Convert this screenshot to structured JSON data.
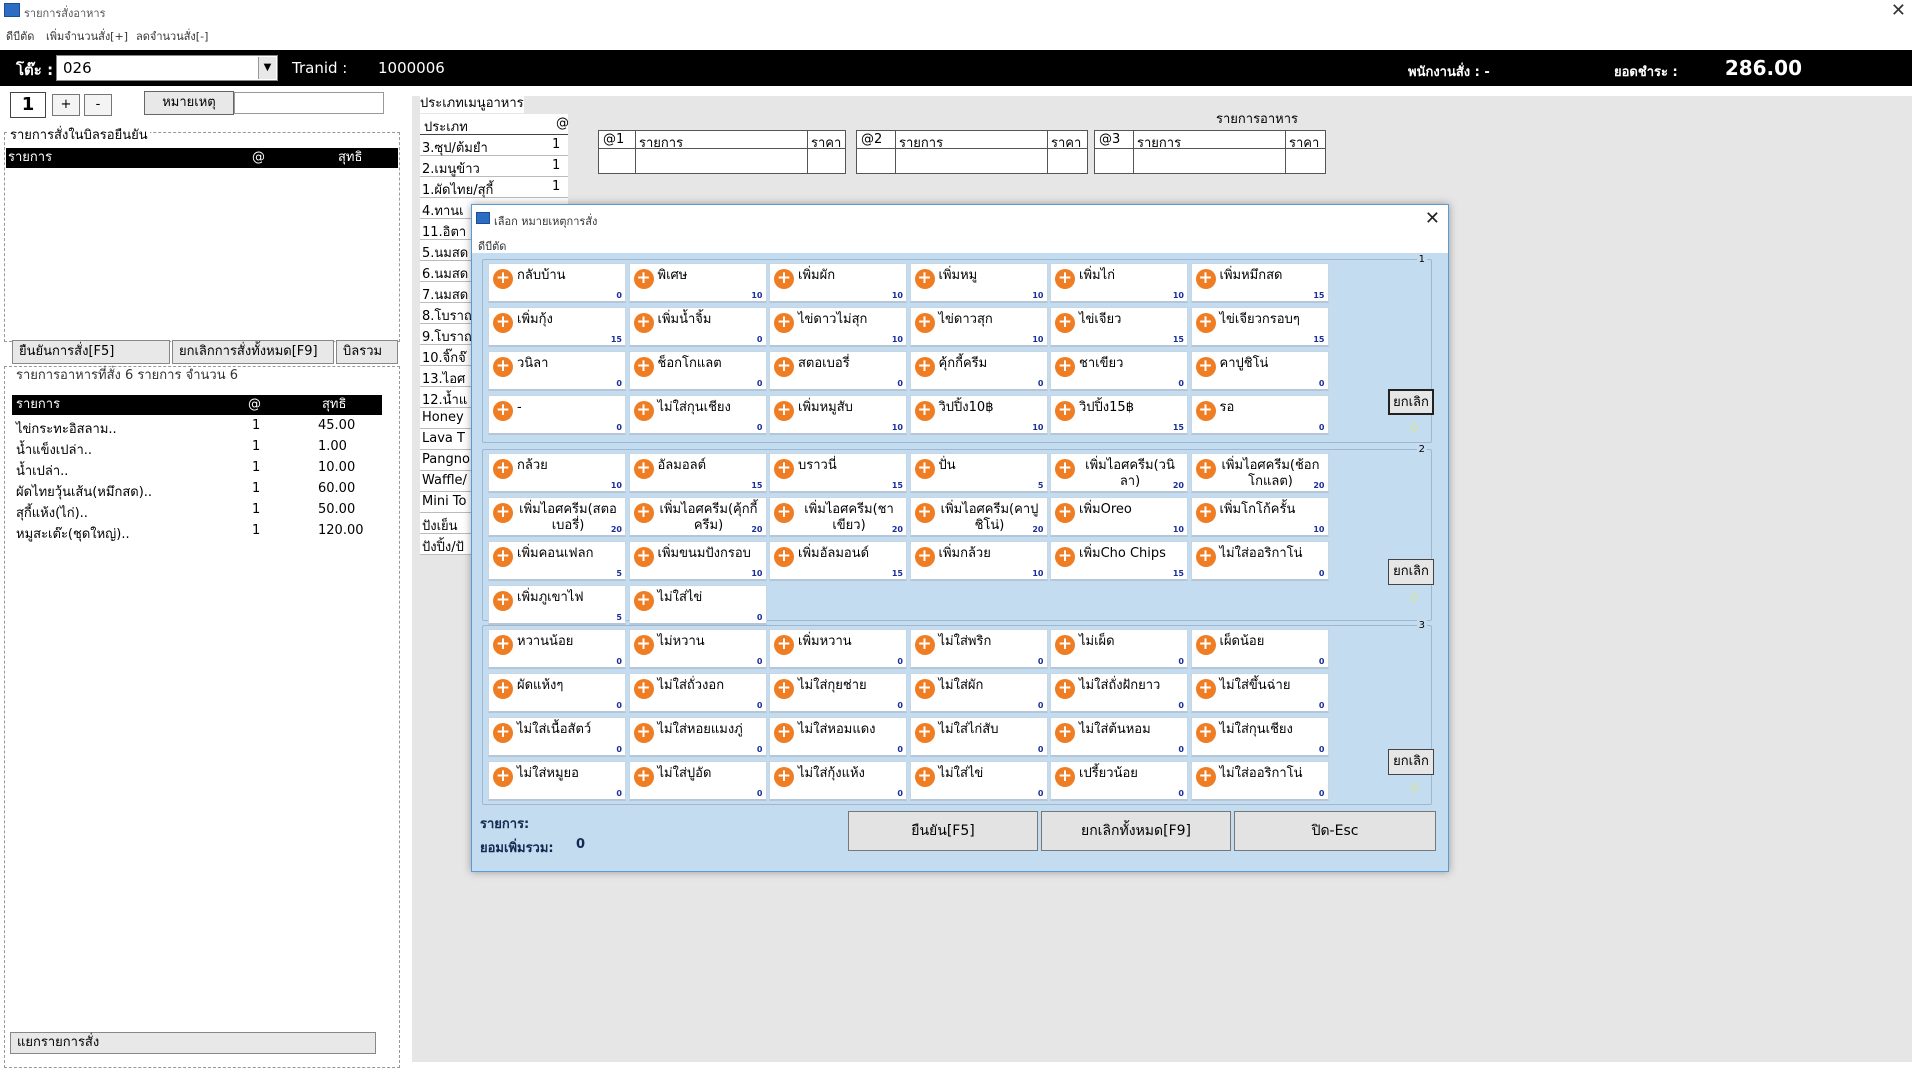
{
  "window": {
    "title": "รายการสั่งอาหาร"
  },
  "menu": [
    "ดีบีตัด",
    "เพิ่มจำนวนสั่ง[+]",
    "ลดจำนวนสั่ง[-]"
  ],
  "header": {
    "table_label": "โต๊ะ :",
    "table_value": "026",
    "tranid_label": "Tranid :",
    "tranid_value": "1000006",
    "staff_label": "พนักงานสั่ง : -",
    "amount_label": "ยอดชำระ :",
    "amount_value": "286.00"
  },
  "left": {
    "qty": "1",
    "plus": "+",
    "minus": "-",
    "note_button": "หมายเหตุ",
    "pending_title": "รายการสั่งในบิลรอยืนยัน",
    "pending_cols": [
      "รายการ",
      "@",
      "สุทธิ"
    ],
    "confirm_btn": "ยืนยันการสั่ง[F5]",
    "cancel_all_btn": "ยกเลิกการสั่งทั้งหมด[F9]",
    "bill_btn": "บิลรวม",
    "summary_text": "รายการอาหารที่สั่ง  6 รายการ    จำนวน  6",
    "ordered_cols": [
      "รายการ",
      "@",
      "สุทธิ"
    ],
    "ordered_rows": [
      [
        "ไข่กระทะอิสลาม..",
        "1",
        "45.00"
      ],
      [
        "น้ำแข็งเปล่า..",
        "1",
        "1.00"
      ],
      [
        "น้ำเปล่า..",
        "1",
        "10.00"
      ],
      [
        "ผัดไทยวุ้นเส้น(หมึกสด)..",
        "1",
        "60.00"
      ],
      [
        "สุกี้แห้ง(ไก่)..",
        "1",
        "50.00"
      ],
      [
        "หมูสะเต๊ะ(ชุดใหญ่)..",
        "1",
        "120.00"
      ]
    ],
    "split_btn": "แยกรายการสั่ง"
  },
  "center": {
    "category_title": "ประเภทเมนูอาหาร",
    "food_title": "รายการอาหาร",
    "cat_cols": [
      "ประเภท",
      "@"
    ],
    "categories": [
      [
        "3.ซุป/ต้มยำ",
        "1"
      ],
      [
        "2.เมนูข้าว",
        "1"
      ],
      [
        "1.ผัดไทย/สุกี้",
        "1"
      ],
      [
        "4.ทานเ",
        ""
      ],
      [
        "11.อิตา",
        ""
      ],
      [
        "5.นมสด",
        ""
      ],
      [
        "6.นมสด",
        ""
      ],
      [
        "7.นมสด",
        ""
      ],
      [
        "8.โบราณ",
        ""
      ],
      [
        "9.โบราณ",
        ""
      ],
      [
        "10.จิ๊กจ๊",
        ""
      ],
      [
        "13.ไอศ",
        ""
      ],
      [
        "12.น้ำแ",
        ""
      ],
      [
        "Honey",
        ""
      ],
      [
        "Lava T",
        ""
      ],
      [
        "Pangno",
        ""
      ],
      [
        "Waffle/",
        ""
      ],
      [
        "Mini To",
        ""
      ],
      [
        "ปังเย็น",
        ""
      ],
      [
        "ปังปิ้ง/ปั",
        ""
      ]
    ],
    "grid1": [
      "@1",
      "รายการ",
      "ราคา"
    ],
    "grid2": [
      "@2",
      "รายการ",
      "ราคา"
    ],
    "grid3": [
      "@3",
      "รายการ",
      "ราคา"
    ]
  },
  "dialog": {
    "title": "เลือก หมายเหตุการสั่ง",
    "menu": "ดีบีตัด",
    "groups": [
      {
        "num": "1",
        "cancel": "ยกเลิก",
        "zero": "0",
        "items": [
          [
            "กลับบ้าน",
            "0"
          ],
          [
            "พิเศษ",
            "10"
          ],
          [
            "เพิ่มผัก",
            "10"
          ],
          [
            "เพิ่มหมู",
            "10"
          ],
          [
            "เพิ่มไก่",
            "10"
          ],
          [
            "เพิ่มหมึกสด",
            "15"
          ],
          [
            "เพิ่มกุ้ง",
            "15"
          ],
          [
            "เพิ่มน้ำจิ้ม",
            "0"
          ],
          [
            "ไข่ดาวไม่สุก",
            "10"
          ],
          [
            "ไข่ดาวสุก",
            "10"
          ],
          [
            "ไข่เจียว",
            "15"
          ],
          [
            "ไข่เจียวกรอบๆ",
            "15"
          ],
          [
            "วนิลา",
            "0"
          ],
          [
            "ช็อกโกแลต",
            "0"
          ],
          [
            "สตอเบอรี่",
            "0"
          ],
          [
            "คุ้กกี้ครีม",
            "0"
          ],
          [
            "ชาเขียว",
            "0"
          ],
          [
            "คาปูชิโน่",
            "0"
          ],
          [
            "-",
            "0"
          ],
          [
            "ไม่ใส่กุนเชียง",
            "0"
          ],
          [
            "เพิ่มหมูสับ",
            "10"
          ],
          [
            "วิปปิ้ง10฿",
            "10"
          ],
          [
            "วิปปิ้ง15฿",
            "15"
          ],
          [
            "รอ",
            "0"
          ]
        ]
      },
      {
        "num": "2",
        "cancel": "ยกเลิก",
        "zero": "0",
        "items": [
          [
            "กล้วย",
            "10"
          ],
          [
            "อัลมอลต์",
            "15"
          ],
          [
            "บราวนี่",
            "15"
          ],
          [
            "ปั่น",
            "5"
          ],
          [
            "เพิ่มไอศครีม(วนิลา)",
            "20"
          ],
          [
            "เพิ่มไอศครีม(ช้อกโกแลต)",
            "20"
          ],
          [
            "เพิ่มไอศครีม(สตอเบอรี่)",
            "20"
          ],
          [
            "เพิ่มไอศครีม(คุ้กกี้ครีม)",
            "20"
          ],
          [
            "เพิ่มไอศครีม(ชาเขียว)",
            "20"
          ],
          [
            "เพิ่มไอศครีม(คาปูชิโน่)",
            "20"
          ],
          [
            "เพิ่มOreo",
            "10"
          ],
          [
            "เพิ่มโกโก้ครั้น",
            "10"
          ],
          [
            "เพิ่มคอนเฟลก",
            "5"
          ],
          [
            "เพิ่มขนมปังกรอบ",
            "10"
          ],
          [
            "เพิ่มอัลมอนด์",
            "15"
          ],
          [
            "เพิ่มกล้วย",
            "10"
          ],
          [
            "เพิ่มCho Chips",
            "15"
          ],
          [
            "ไม่ใส่ออริกาโน่",
            "0"
          ],
          [
            "เพิ่มภูเขาไฟ",
            "5"
          ],
          [
            "ไม่ใส่ไข่",
            "0"
          ]
        ]
      },
      {
        "num": "3",
        "cancel": "ยกเลิก",
        "zero": "0",
        "items": [
          [
            "หวานน้อย",
            "0"
          ],
          [
            "ไม่หวาน",
            "0"
          ],
          [
            "เพิ่มหวาน",
            "0"
          ],
          [
            "ไม่ใส่พริก",
            "0"
          ],
          [
            "ไม่เผ็ด",
            "0"
          ],
          [
            "เผ็ดน้อย",
            "0"
          ],
          [
            "ผัดแห้งๆ",
            "0"
          ],
          [
            "ไม่ใส่ถั่วงอก",
            "0"
          ],
          [
            "ไม่ใส่กุยช่าย",
            "0"
          ],
          [
            "ไม่ใส่ผัก",
            "0"
          ],
          [
            "ไม่ใส่ถั่งฝักยาว",
            "0"
          ],
          [
            "ไม่ใส่ขึ้นฉ่าย",
            "0"
          ],
          [
            "ไม่ใส่เนื้อสัตว์",
            "0"
          ],
          [
            "ไม่ใส่หอยแมงภู่",
            "0"
          ],
          [
            "ไม่ใส่หอมแดง",
            "0"
          ],
          [
            "ไม่ใส่ไก่สับ",
            "0"
          ],
          [
            "ไม่ใส่ต้นหอม",
            "0"
          ],
          [
            "ไม่ใส่กุนเชียง",
            "0"
          ],
          [
            "ไม่ใส่หมูยอ",
            "0"
          ],
          [
            "ไม่ใส่ปูอัด",
            "0"
          ],
          [
            "ไม่ใส่กุ้งแห้ง",
            "0"
          ],
          [
            "ไม่ใส่ไข่",
            "0"
          ],
          [
            "เปรี้ยวน้อย",
            "0"
          ],
          [
            "ไม่ใส่ออริกาโน่",
            "0"
          ]
        ]
      }
    ],
    "items_label": "รายการ:",
    "sum_label": "ยอมเพิ่มรวม:",
    "sum_value": "0",
    "confirm": "ยืนยัน[F5]",
    "cancel_all": "ยกเลิกทั้งหมด[F9]",
    "close": "ปิด-Esc"
  }
}
